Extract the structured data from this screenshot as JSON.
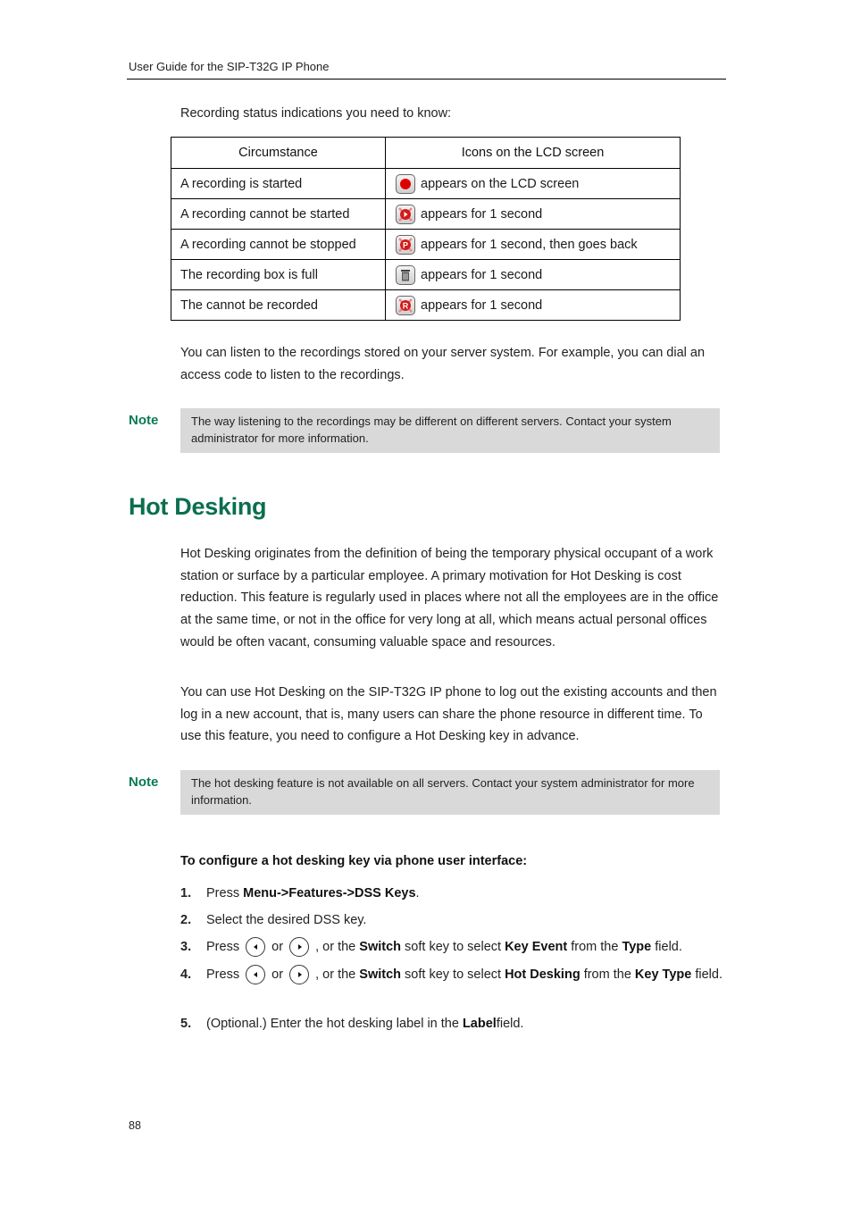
{
  "header": {
    "title": "User Guide for the SIP-T32G IP Phone"
  },
  "intro": "Recording status indications you need to know:",
  "status_table": {
    "columns": [
      "Circumstance",
      "Icons on the LCD screen"
    ],
    "rows": [
      {
        "circumstance": "A recording is started",
        "icon": "record-dot-icon",
        "text": "appears on the LCD screen"
      },
      {
        "circumstance": "A recording cannot be started",
        "icon": "record-start-failed-icon",
        "text": "appears for 1 second"
      },
      {
        "circumstance": "A recording cannot be stopped",
        "icon": "record-pause-failed-icon",
        "text": "appears for 1 second, then goes back"
      },
      {
        "circumstance": "The recording box is full",
        "icon": "recording-box-full-icon",
        "text": "appears for 1 second"
      },
      {
        "circumstance": "The cannot be recorded",
        "icon": "cannot-record-icon",
        "text": "appears for 1 second"
      }
    ]
  },
  "listen_paragraph": "You can listen to the recordings stored on your server system. For example, you can dial an access code to listen to the recordings.",
  "note1": {
    "label": "Note",
    "text": "The way listening to the recordings may be different on different servers. Contact your system administrator for more information."
  },
  "section": {
    "title": "Hot Desking",
    "paragraph1": "Hot Desking originates from the definition of being the temporary physical occupant of a work station or surface by a particular employee. A primary motivation for Hot Desking is cost reduction. This feature is regularly used in places where not all the employees are in the office at the same time, or not in the office for very long at all, which means actual personal offices would be often vacant, consuming valuable space and resources.",
    "paragraph2": "You can use Hot Desking on the SIP-T32G IP phone to log out the existing accounts and then log in a new account, that is, many users can share the phone resource in different time. To use this feature, you need to configure a Hot Desking key in advance."
  },
  "note2": {
    "label": "Note",
    "text": "The hot desking feature is not available on all servers. Contact your system administrator for more information."
  },
  "procedure": {
    "title": "To configure a hot desking key via phone user interface:",
    "steps": [
      {
        "num": "1.",
        "press": "Press",
        "menu_path": "Menu->Features->DSS Keys",
        "end": "."
      },
      {
        "num": "2.",
        "text": "Select the desired DSS key."
      },
      {
        "num": "3.",
        "press": "Press",
        "or": "or",
        "mid": ", or the",
        "switch": "Switch",
        "mid2": "soft key to select",
        "value": "Key Event",
        "mid3": "from the",
        "field": "Type",
        "end": "field."
      },
      {
        "num": "4.",
        "press": "Press",
        "or": "or",
        "mid": ", or the",
        "switch": "Switch",
        "mid2": "soft key to select",
        "value": "Hot Desking",
        "mid3": "from the",
        "field": "Key Type",
        "end": "field."
      },
      {
        "num": "5.",
        "pre": "(Optional.) Enter the hot desking label in the",
        "field": "Label",
        "end": "field."
      }
    ]
  },
  "page_number": "88"
}
